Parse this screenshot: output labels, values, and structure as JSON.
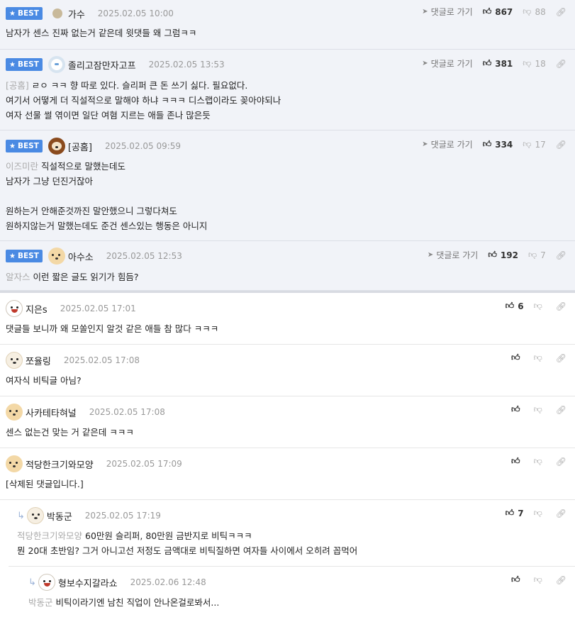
{
  "labels": {
    "best": "BEST",
    "goto": "댓글로 가기"
  },
  "best": [
    {
      "nick": "가수",
      "date": "2025.02.05 10:00",
      "up": "867",
      "down": "88",
      "lines": [
        {
          "mention": "",
          "text": "남자가 센스 진짜 없는거 같은데 윗댓들 왜 그럼ㅋㅋ"
        }
      ]
    },
    {
      "nick": "졸리고잠만자고프",
      "date": "2025.02.05 13:53",
      "up": "381",
      "down": "18",
      "lines": [
        {
          "mention": "[공홈]",
          "text": "ㄹㅇ ㅋㅋ 향 따로 있다. 슬리퍼 큰 돈 쓰기 싫다. 필요없다."
        },
        {
          "mention": "",
          "text": "여기서 어떻게 더 직설적으로 말해야 하냐 ㅋㅋㅋ 디스랩이라도 꽂아야되나"
        },
        {
          "mention": "",
          "text": "여자 선물 썰 엮이면 일단 여혐 지르는 애들 존나 많은듯"
        }
      ]
    },
    {
      "nick": "[공홈]",
      "date": "2025.02.05 09:59",
      "up": "334",
      "down": "17",
      "lines": [
        {
          "mention": "이즈미란",
          "text": "직설적으로 말했는데도"
        },
        {
          "mention": "",
          "text": "남자가 그냥 던진거잖아"
        },
        {
          "mention": "",
          "text": ""
        },
        {
          "mention": "",
          "text": "원하는거 안해준것까진 말안했으니 그렇다쳐도"
        },
        {
          "mention": "",
          "text": "원하지않는거 말했는데도 준건 센스있는 행동은 아니지"
        }
      ]
    },
    {
      "nick": "아수소",
      "date": "2025.02.05 12:53",
      "up": "192",
      "down": "7",
      "lines": [
        {
          "mention": "알자스",
          "text": "이런 짧은 글도 읽기가 힘듬?"
        }
      ]
    }
  ],
  "comments": [
    {
      "nick": "지은s",
      "date": "2025.02.05 17:01",
      "up": "6",
      "down": "",
      "lines": [
        {
          "mention": "",
          "text": "댓글들 보니까 왜 모쏠인지 알것 같은 애들 참 많다 ㅋㅋㅋ"
        }
      ]
    },
    {
      "nick": "쪼율링",
      "date": "2025.02.05 17:08",
      "up": "",
      "down": "",
      "lines": [
        {
          "mention": "",
          "text": "여자식 비틱글 아님?"
        }
      ]
    },
    {
      "nick": "사카테타혀널",
      "date": "2025.02.05 17:08",
      "up": "",
      "down": "",
      "lines": [
        {
          "mention": "",
          "text": "센스 없는건 맞는 거 같은데 ㅋㅋㅋ"
        }
      ]
    },
    {
      "nick": "적당한크기와모양",
      "date": "2025.02.05 17:09",
      "up": "",
      "down": "",
      "lines": [
        {
          "mention": "",
          "text": "[삭제된 댓글입니다.]"
        }
      ]
    },
    {
      "nick": "박동군",
      "date": "2025.02.05 17:19",
      "up": "7",
      "down": "",
      "lines": [
        {
          "mention": "적당한크기와모양",
          "text": "60만원 슬리퍼, 80만원 금반지로 비틱ㅋㅋㅋ"
        },
        {
          "mention": "",
          "text": "뭔 20대 초반임? 그거 아니고선 저정도 금액대로 비틱질하면 여자들 사이에서 오히려 꼽먹어"
        }
      ]
    },
    {
      "nick": "형보수지갈라쇼",
      "date": "2025.02.06 12:48",
      "up": "",
      "down": "",
      "lines": [
        {
          "mention": "박동군",
          "text": "비틱이라기엔 남친 직업이 안나온걸로봐서..."
        }
      ]
    }
  ]
}
